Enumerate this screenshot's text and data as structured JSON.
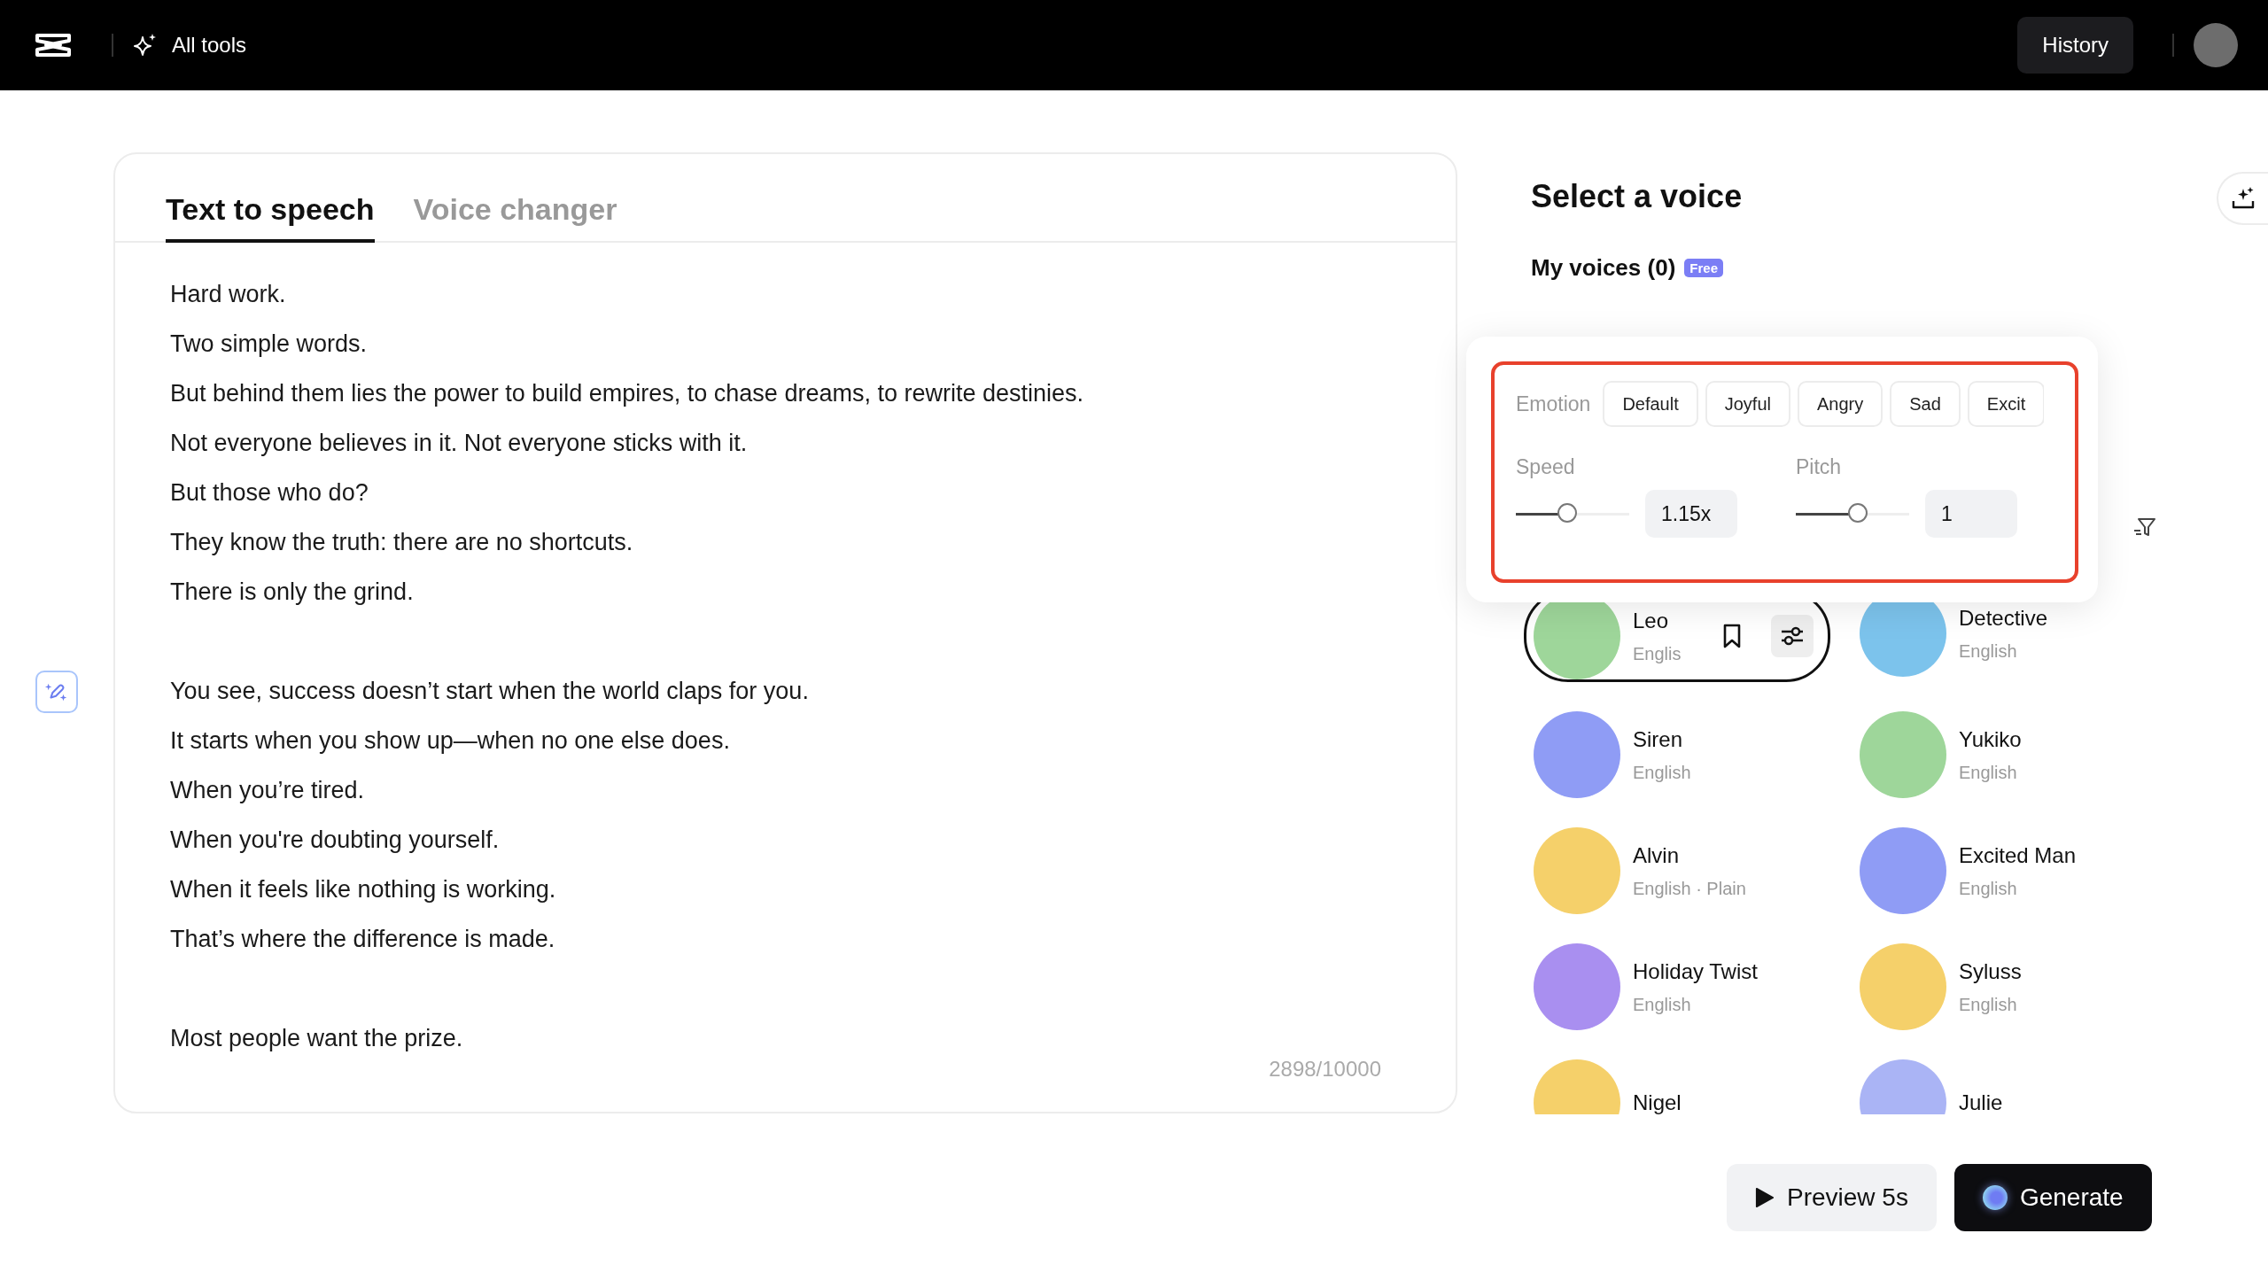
{
  "topbar": {
    "all_tools": "All tools",
    "history": "History"
  },
  "tabs": [
    {
      "label": "Text to speech",
      "selected": true
    },
    {
      "label": "Voice changer",
      "selected": false
    }
  ],
  "editor": {
    "paragraphs": [
      [
        "Hard work.",
        "Two simple words.",
        "But behind them lies the power to build empires, to chase dreams, to rewrite destinies.",
        "Not everyone believes in it. Not everyone sticks with it.",
        "But those who do?",
        "They know the truth: there are no shortcuts.",
        "There is only the grind."
      ],
      [
        "You see, success doesn’t start when the world claps for you.",
        "It starts when you show up—when no one else does.",
        "When you’re tired.",
        "When you're doubting yourself.",
        "When it feels like nothing is working.",
        "That’s where the difference is made."
      ],
      [
        "Most people want the prize."
      ]
    ],
    "counter": "2898/10000"
  },
  "voice_panel": {
    "title": "Select a voice",
    "my_voices": "My voices (0)",
    "badge": "Free"
  },
  "popup": {
    "emotion_label": "Emotion",
    "emotions": [
      "Default",
      "Joyful",
      "Angry",
      "Sad",
      "Excit"
    ],
    "speed": {
      "label": "Speed",
      "level": 0.45,
      "value": "1.15x"
    },
    "pitch": {
      "label": "Pitch",
      "level": 0.55,
      "value": "1"
    }
  },
  "voices": [
    {
      "name": "Leo",
      "language": "Englis",
      "selected": true,
      "color": "#9ed69a"
    },
    {
      "name": "Detective",
      "language": "English",
      "selected": false,
      "color": "#7cc3ec"
    },
    {
      "name": "Siren",
      "language": "English",
      "selected": false,
      "color": "#8f9cf5"
    },
    {
      "name": "Yukiko",
      "language": "English",
      "selected": false,
      "color": "#9ed69a"
    },
    {
      "name": "Alvin",
      "language": "English · Plain",
      "selected": false,
      "color": "#f5d06a"
    },
    {
      "name": "Excited Man",
      "language": "English",
      "selected": false,
      "color": "#8f9cf5"
    },
    {
      "name": "Holiday Twist",
      "language": "English",
      "selected": false,
      "color": "#a98ff0"
    },
    {
      "name": "Syluss",
      "language": "English",
      "selected": false,
      "color": "#f5d06a"
    },
    {
      "name": "Nigel",
      "selected": false,
      "color": "#f5d06a"
    },
    {
      "name": "Julie",
      "selected": false,
      "color": "#aab4f5"
    }
  ],
  "buttons": {
    "preview": "Preview 5s",
    "generate": "Generate"
  }
}
